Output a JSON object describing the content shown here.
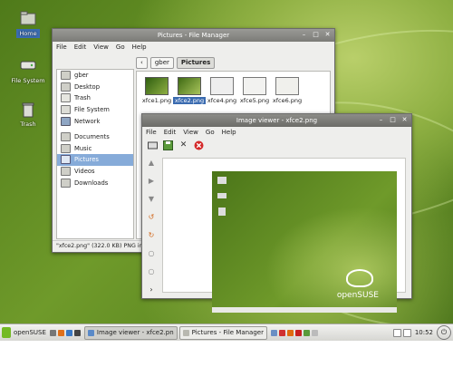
{
  "desktop": {
    "icons": [
      {
        "label": "Home"
      },
      {
        "label": "File System"
      },
      {
        "label": "Trash"
      }
    ]
  },
  "file_manager": {
    "title": "Pictures - File Manager",
    "menu": [
      "File",
      "Edit",
      "View",
      "Go",
      "Help"
    ],
    "path": [
      "gber",
      "Pictures"
    ],
    "sidebar": [
      "gber",
      "Desktop",
      "Trash",
      "File System",
      "Network",
      "Documents",
      "Music",
      "Pictures",
      "Videos",
      "Downloads"
    ],
    "selected_place": "Pictures",
    "files": [
      "xfce1.png",
      "xfce2.png",
      "xfce4.png",
      "xfce5.png",
      "xfce6.png"
    ],
    "selected_file": "xfce2.png",
    "status": "\"xfce2.png\" (322.0 KB) PNG ima"
  },
  "image_viewer": {
    "title": "Image viewer - xfce2.png",
    "menu": [
      "File",
      "Edit",
      "View",
      "Go",
      "Help"
    ],
    "preview_brand": "openSUSE"
  },
  "panel": {
    "start_label": "openSUSE",
    "tasks": [
      "Image viewer - xfce2.pn",
      "Pictures - File Manager"
    ],
    "clock": "10:52"
  },
  "colors": {
    "accent": "#3a6bb0",
    "desktop_green": "#6f9a2a"
  }
}
